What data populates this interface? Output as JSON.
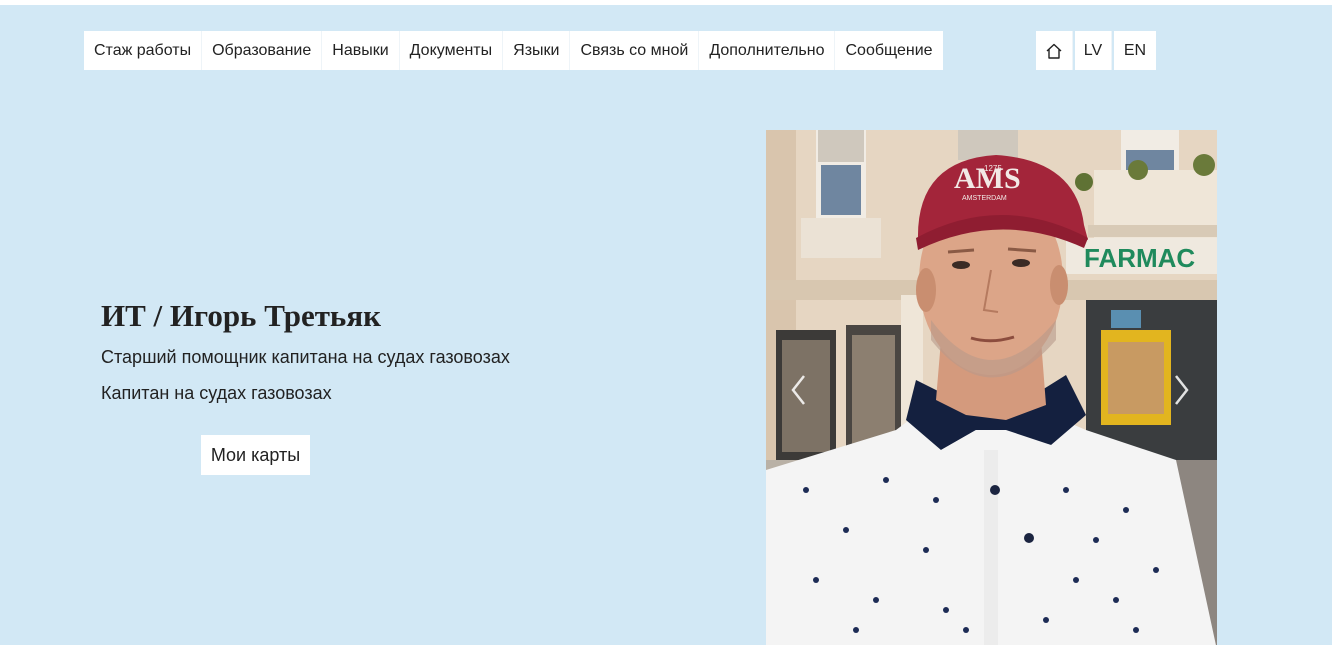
{
  "nav": {
    "items": [
      {
        "id": "experience",
        "label": "Стаж работы"
      },
      {
        "id": "education",
        "label": "Образование"
      },
      {
        "id": "skills",
        "label": "Навыки"
      },
      {
        "id": "documents",
        "label": "Документы"
      },
      {
        "id": "languages",
        "label": "Языки"
      },
      {
        "id": "contact",
        "label": "Связь со мной"
      },
      {
        "id": "additional",
        "label": "Дополнительно"
      },
      {
        "id": "message",
        "label": "Сообщение"
      }
    ],
    "home_icon": "home-icon",
    "lang_lv": "LV",
    "lang_en": "EN"
  },
  "hero": {
    "title": "ИТ / Игорь Третьяк",
    "line1": "Старший помощник капитана на судах газовозах",
    "line2": "Капитан на судах газовозах",
    "button_label": "Мои карты"
  },
  "carousel": {
    "photo": {
      "cap_text": "AMS",
      "cap_number": "1275",
      "cap_city": "AMSTERDAM",
      "shop_sign": "FARMAC"
    },
    "prev_icon": "chevron-left-icon",
    "next_icon": "chevron-right-icon"
  },
  "colors": {
    "background": "#d2e8f5",
    "nav_background": "#ffffff",
    "text": "#222222",
    "cap": "#a3253a",
    "shirt": "#f4f4f4"
  }
}
